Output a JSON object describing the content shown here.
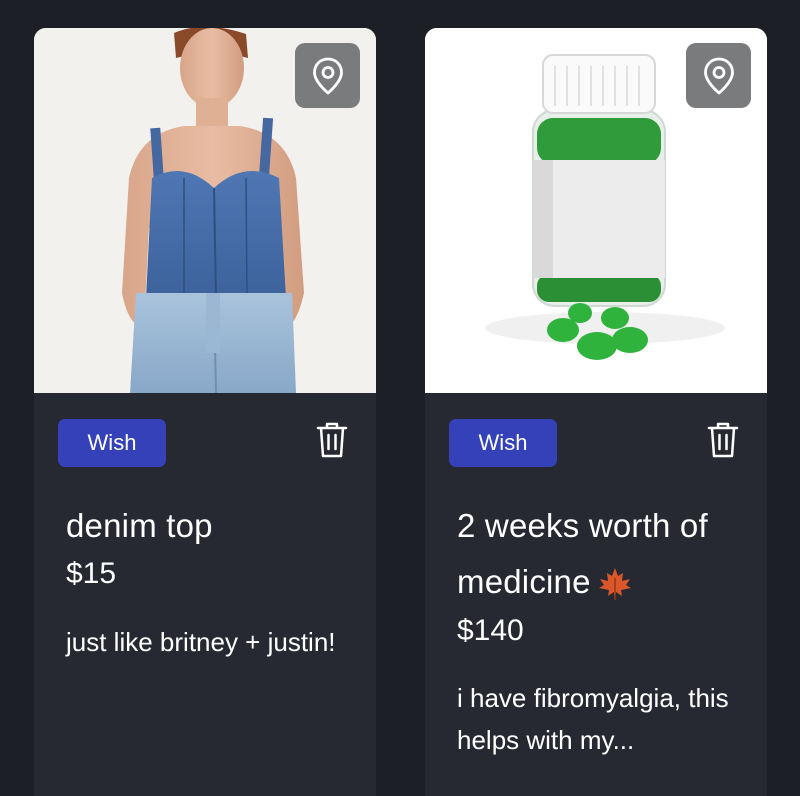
{
  "items": [
    {
      "badge": "Wish",
      "title": "denim top",
      "price": "$15",
      "description": "just like britney + justin!",
      "image_icon": "denim-top-photo",
      "location_icon": "map-pin-icon",
      "delete_icon": "trash-icon"
    },
    {
      "badge": "Wish",
      "title": "2 weeks worth of medicine",
      "title_emoji_icon": "maple-leaf-icon",
      "price": "$140",
      "description": "i have fibromyalgia, this helps with my...",
      "image_icon": "gummy-jar-photo",
      "location_icon": "map-pin-icon",
      "delete_icon": "trash-icon"
    }
  ],
  "colors": {
    "background": "#1c1f26",
    "card": "#262931",
    "badge": "#3441b8",
    "text": "#ffffff"
  }
}
